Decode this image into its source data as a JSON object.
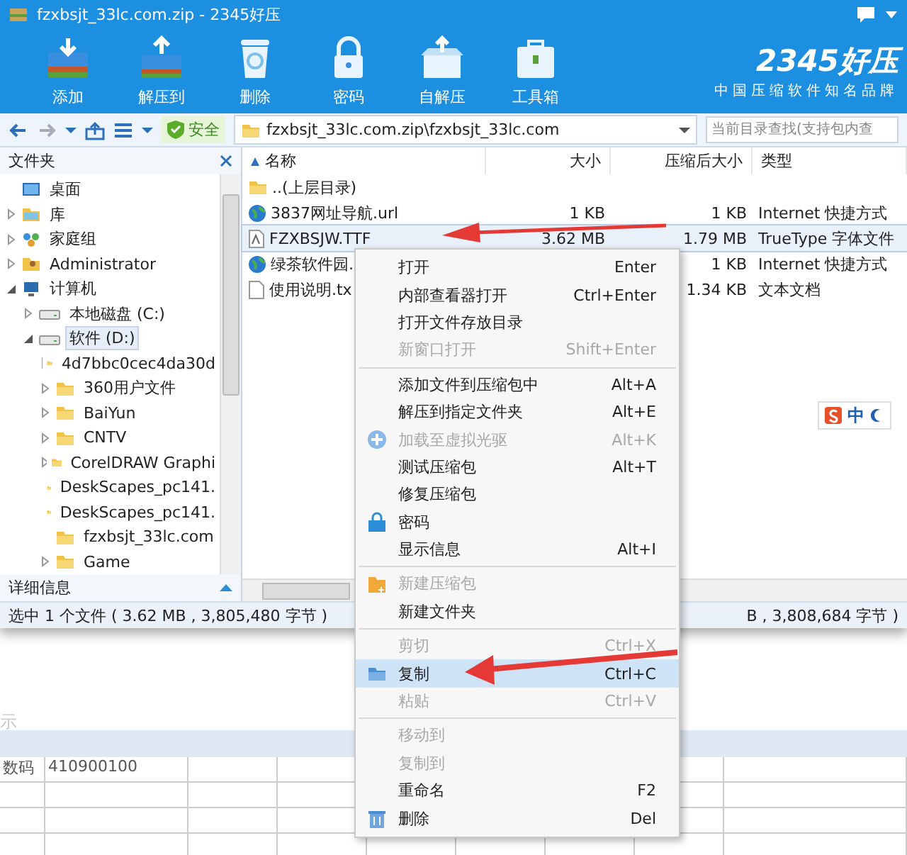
{
  "window": {
    "title": "fzxbsjt_33lc.com.zip - 2345好压"
  },
  "toolbar": {
    "buttons": [
      {
        "label": "添加"
      },
      {
        "label": "解压到"
      },
      {
        "label": "删除"
      },
      {
        "label": "密码"
      },
      {
        "label": "自解压"
      },
      {
        "label": "工具箱"
      }
    ],
    "brand": {
      "name": "2345好压",
      "slogan": "中国压缩软件知名品牌"
    }
  },
  "address_bar": {
    "security": "安全",
    "path": "fzxbsjt_33lc.com.zip\\fzxbsjt_33lc.com",
    "search": {
      "placeholder": "当前目录查找(支持包内查"
    }
  },
  "folder_panel": {
    "title": "文件夹",
    "footer": "详细信息",
    "tree": [
      {
        "label": "桌面",
        "kind": "desktop",
        "selected": false
      },
      {
        "label": "库",
        "kind": "library",
        "expanded": false,
        "selected": false
      },
      {
        "label": "家庭组",
        "kind": "group",
        "expanded": false,
        "selected": false
      },
      {
        "label": "Administrator",
        "kind": "user",
        "expanded": false,
        "selected": false
      },
      {
        "label": "计算机",
        "kind": "computer",
        "expanded": true,
        "selected": false,
        "children": [
          {
            "label": "本地磁盘 (C:)",
            "kind": "drive",
            "expanded": false,
            "selected": false
          },
          {
            "label": "软件 (D:)",
            "kind": "drive",
            "expanded": true,
            "selected": true,
            "children": [
              {
                "label": "4d7bbc0cec4da30d",
                "kind": "folder",
                "expanded": false,
                "selected": false
              },
              {
                "label": "360用户文件",
                "kind": "folder",
                "expanded": false,
                "selected": false
              },
              {
                "label": "BaiYun",
                "kind": "folder",
                "expanded": false,
                "selected": false
              },
              {
                "label": "CNTV",
                "kind": "folder",
                "expanded": false,
                "selected": false
              },
              {
                "label": "CorelDRAW Graphi",
                "kind": "folder",
                "expanded": false,
                "selected": false
              },
              {
                "label": "DeskScapes_pc141.",
                "kind": "folder",
                "selected": false
              },
              {
                "label": "DeskScapes_pc141.",
                "kind": "folder",
                "selected": false
              },
              {
                "label": "fzxbsjt_33lc.com",
                "kind": "folder",
                "selected": false
              },
              {
                "label": "Game",
                "kind": "folder",
                "expanded": false,
                "selected": false
              }
            ]
          }
        ]
      }
    ]
  },
  "file_list": {
    "columns": [
      "名称",
      "大小",
      "压缩后大小",
      "类型"
    ],
    "rows": [
      {
        "name": "..(上层目录)",
        "kind": "folder",
        "selected": false
      },
      {
        "name": "3837网址导航.url",
        "kind": "link",
        "size": "1 KB",
        "packed": "1 KB",
        "type": "Internet 快捷方式",
        "selected": false
      },
      {
        "name": "FZXBSJW.TTF",
        "kind": "font",
        "size": "3.62 MB",
        "packed": "1.79 MB",
        "type": "TrueType 字体文件",
        "selected": true
      },
      {
        "name": "绿茶软件园.",
        "kind": "link",
        "packed": "1 KB",
        "type": "Internet 快捷方式",
        "selected": false
      },
      {
        "name": "使用说明.tx",
        "kind": "text",
        "packed": "1.34 KB",
        "type": "文本文档",
        "selected": false
      }
    ]
  },
  "status_bar": {
    "left": "选中 1 个文件 ( 3.62 MB , 3,805,480 字节 )",
    "right": "B , 3,808,684 字节 )"
  },
  "context_menu": {
    "items": [
      {
        "kind": "item",
        "label": "打开",
        "shortcut": "Enter",
        "disabled": false,
        "selected": false
      },
      {
        "kind": "item",
        "label": "内部查看器打开",
        "shortcut": "Ctrl+Enter",
        "disabled": false,
        "selected": false
      },
      {
        "kind": "item",
        "label": "打开文件存放目录",
        "disabled": false,
        "selected": false
      },
      {
        "kind": "item",
        "label": "新窗口打开",
        "shortcut": "Shift+Enter",
        "disabled": true,
        "selected": false
      },
      {
        "kind": "separator"
      },
      {
        "kind": "item",
        "label": "添加文件到压缩包中",
        "shortcut": "Alt+A",
        "disabled": false,
        "selected": false
      },
      {
        "kind": "item",
        "label": "解压到指定文件夹",
        "shortcut": "Alt+E",
        "disabled": false,
        "selected": false
      },
      {
        "kind": "item",
        "label": "加载至虚拟光驱",
        "shortcut": "Alt+K",
        "disabled": true,
        "selected": false
      },
      {
        "kind": "item",
        "label": "测试压缩包",
        "shortcut": "Alt+T",
        "disabled": false,
        "selected": false
      },
      {
        "kind": "item",
        "label": "修复压缩包",
        "disabled": false,
        "selected": false
      },
      {
        "kind": "item",
        "label": "密码",
        "disabled": false,
        "selected": false
      },
      {
        "kind": "item",
        "label": "显示信息",
        "shortcut": "Alt+I",
        "disabled": false,
        "selected": false
      },
      {
        "kind": "separator"
      },
      {
        "kind": "item",
        "label": "新建压缩包",
        "disabled": true,
        "selected": false
      },
      {
        "kind": "item",
        "label": "新建文件夹",
        "disabled": false,
        "selected": false
      },
      {
        "kind": "separator"
      },
      {
        "kind": "item",
        "label": "剪切",
        "shortcut": "Ctrl+X",
        "disabled": true,
        "selected": false
      },
      {
        "kind": "item",
        "label": "复制",
        "shortcut": "Ctrl+C",
        "disabled": false,
        "selected": true
      },
      {
        "kind": "item",
        "label": "粘贴",
        "shortcut": "Ctrl+V",
        "disabled": true,
        "selected": false
      },
      {
        "kind": "separator"
      },
      {
        "kind": "item",
        "label": "移动到",
        "disabled": true,
        "selected": false
      },
      {
        "kind": "item",
        "label": "复制到",
        "disabled": true,
        "selected": false
      },
      {
        "kind": "item",
        "label": "重命名",
        "shortcut": "F2",
        "disabled": false,
        "selected": false
      },
      {
        "kind": "item",
        "label": "删除",
        "shortcut": "Del",
        "disabled": false,
        "selected": false
      }
    ]
  },
  "ime_bar": {
    "label": "中"
  },
  "background_sheet": {
    "caption": "示",
    "rows": [
      [
        "数码",
        "410900100"
      ]
    ]
  }
}
